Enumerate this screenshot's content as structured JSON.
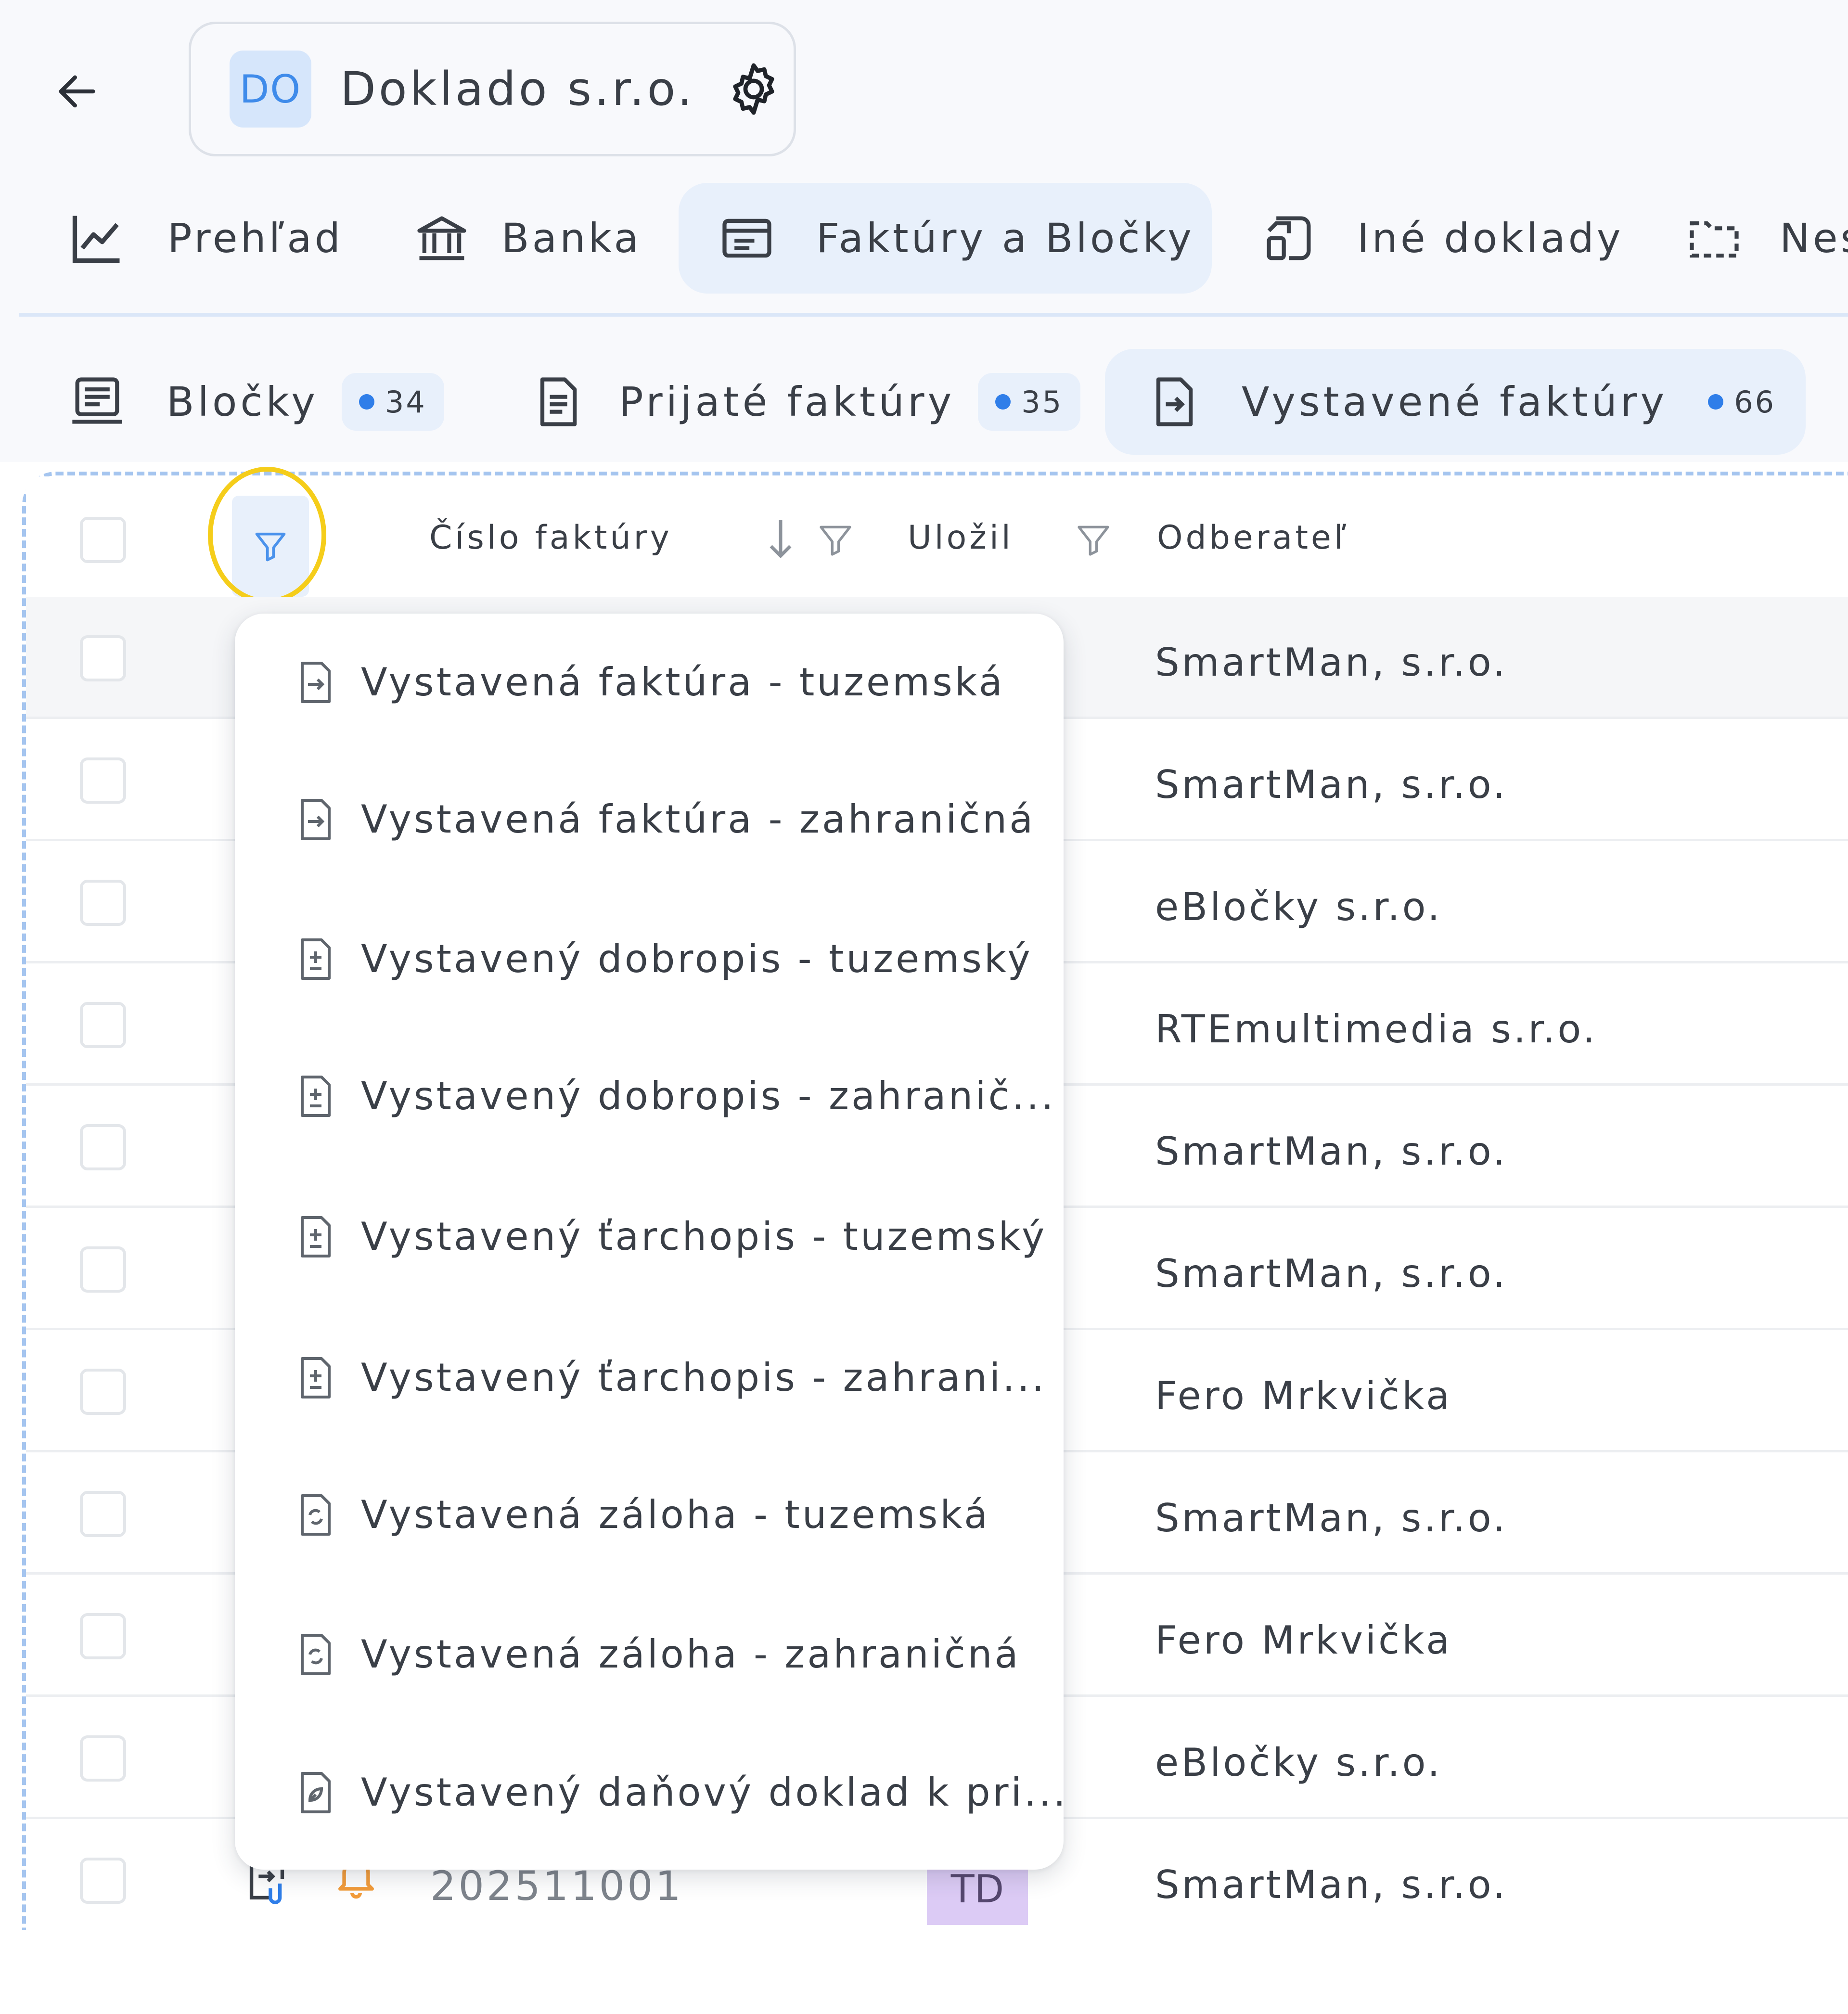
{
  "header": {
    "company_initials": "DO",
    "company_name": "Doklado s.r.o."
  },
  "main_tabs": [
    {
      "label": "Prehľad",
      "icon": "chart-line-icon"
    },
    {
      "label": "Banka",
      "icon": "bank-icon"
    },
    {
      "label": "Faktúry a Bločky",
      "icon": "invoice-icon",
      "active": true
    },
    {
      "label": "Iné doklady",
      "icon": "other-documents-icon"
    },
    {
      "label": "Nes",
      "icon": "folder-dashed-icon"
    }
  ],
  "sub_tabs": [
    {
      "label": "Bločky",
      "count": "34",
      "icon": "receipt-icon"
    },
    {
      "label": "Prijaté faktúry",
      "count": "35",
      "icon": "received-invoice-icon"
    },
    {
      "label": "Vystavené faktúry",
      "count": "66",
      "icon": "issued-invoice-icon",
      "active": true
    }
  ],
  "table": {
    "columns": {
      "invoice_number": "Číslo faktúry",
      "saved_by": "Uložil",
      "customer": "Odberateľ"
    },
    "rows": [
      {
        "customer": "SmartMan, s.r.o."
      },
      {
        "customer": "SmartMan, s.r.o."
      },
      {
        "customer": "eBločky s.r.o."
      },
      {
        "customer": "RTEmultimedia s.r.o."
      },
      {
        "customer": "SmartMan, s.r.o."
      },
      {
        "customer": "SmartMan, s.r.o."
      },
      {
        "customer": "Fero Mrkvička"
      },
      {
        "customer": "SmartMan, s.r.o."
      },
      {
        "customer": "Fero Mrkvička"
      },
      {
        "customer": "eBločky s.r.o."
      },
      {
        "number": "202511001",
        "saved_by": "TD",
        "customer": "SmartMan, s.r.o."
      }
    ]
  },
  "filter_menu": {
    "items": [
      {
        "label": "Vystavená faktúra - tuzemská",
        "icon": "document-arrow-icon"
      },
      {
        "label": "Vystavená faktúra - zahraničná",
        "icon": "document-arrow-icon"
      },
      {
        "label": "Vystavený dobropis - tuzemský",
        "icon": "document-plus-minus-icon"
      },
      {
        "label": "Vystavený dobropis - zahranič...",
        "icon": "document-plus-minus-icon"
      },
      {
        "label": "Vystavený ťarchopis - tuzemský",
        "icon": "document-plus-minus-icon"
      },
      {
        "label": "Vystavený ťarchopis - zahrani...",
        "icon": "document-plus-minus-icon"
      },
      {
        "label": "Vystavená záloha - tuzemská",
        "icon": "document-cycle-icon"
      },
      {
        "label": "Vystavená záloha - zahraničná",
        "icon": "document-cycle-icon"
      },
      {
        "label": "Vystavený daňový doklad k pri...",
        "icon": "document-leaf-icon"
      }
    ]
  },
  "colors": {
    "accent": "#2f7ee9",
    "active_tab_bg": "#e8f0fb",
    "highlight_ring": "#f5cd1a",
    "user_badge": "#dccbf5",
    "bell": "#f39c3a"
  }
}
